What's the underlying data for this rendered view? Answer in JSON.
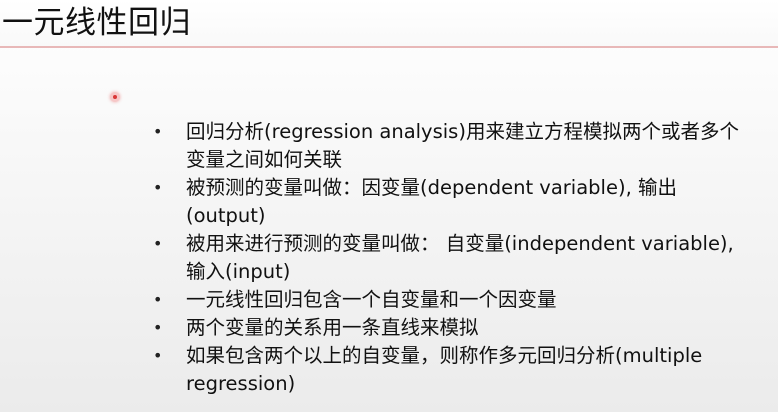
{
  "slide": {
    "title": "一元线性回归",
    "bullet_marker": "•",
    "bullets": [
      "回归分析(regression analysis)用来建立方程模拟两个或者多个变量之间如何关联",
      "被预测的变量叫做：因变量(dependent variable), 输出(output)",
      "被用来进行预测的变量叫做： 自变量(independent variable), 输入(input)",
      "一元线性回归包含一个自变量和一个因变量",
      "两个变量的关系用一条直线来模拟",
      "如果包含两个以上的自变量，则称作多元回归分析(multiple regression)"
    ]
  },
  "colors": {
    "accent_rule": "#e8b8b8",
    "pointer": "#d93636",
    "text": "#111111"
  }
}
